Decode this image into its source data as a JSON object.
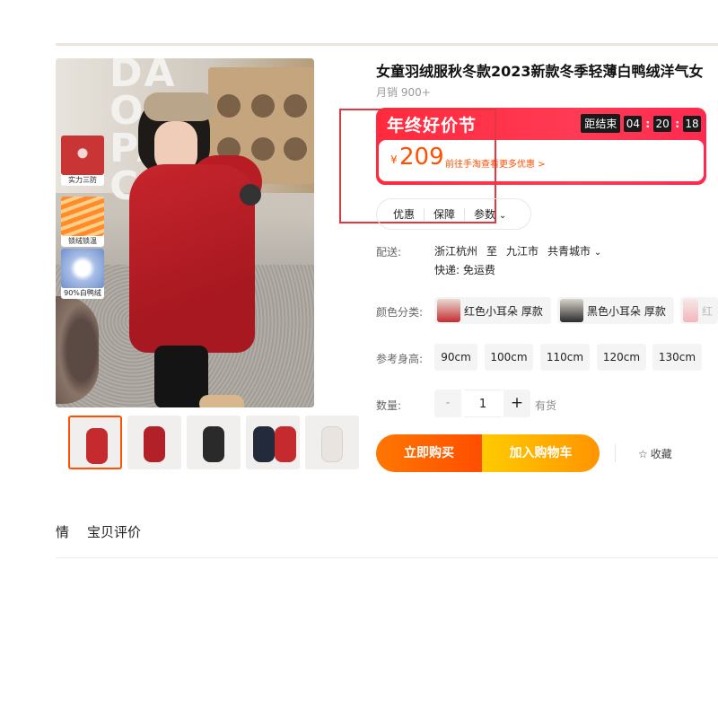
{
  "product": {
    "title": "女童羽绒服秋冬款2023新款冬季轻薄白鸭绒洋气女",
    "sales": "月销 900+"
  },
  "gallery": {
    "main_image_letters": "DA\nOS\nPA\nCE",
    "feature_tiles": [
      "实力三防",
      "锁绒锁温",
      "90%白鸭绒"
    ],
    "thumbnails": [
      {
        "color": "#c52a2f",
        "active": true
      },
      {
        "color": "#b22127",
        "active": false
      },
      {
        "color": "#2a2a2a",
        "active": false
      },
      {
        "color": "#222a3c",
        "active": false
      },
      {
        "color": "#e9e4df",
        "active": false
      }
    ]
  },
  "promo": {
    "title": "年终好价节",
    "countdown_label": "距结束",
    "hours": "04",
    "minutes": "20",
    "seconds": "18",
    "currency": "¥",
    "price": "209",
    "more_offers": "前往手淘查看更多优惠 >"
  },
  "info_tabs": [
    "优惠",
    "保障",
    "参数"
  ],
  "shipping": {
    "label": "配送:",
    "from": "浙江杭州",
    "to_word": "至",
    "to_city": "九江市",
    "district": "共青城市",
    "express": "快递: 免运费"
  },
  "colors": {
    "label": "颜色分类:",
    "options": [
      {
        "name": "红色小耳朵 厚款",
        "swatch": "#c62b31"
      },
      {
        "name": "黑色小耳朵 厚款",
        "swatch": "#2b2b2b"
      },
      {
        "name": "红",
        "swatch": "#f1b6bd"
      }
    ]
  },
  "sizes": {
    "label": "参考身高:",
    "options": [
      "90cm",
      "100cm",
      "110cm",
      "120cm",
      "130cm"
    ]
  },
  "quantity": {
    "label": "数量:",
    "minus": "-",
    "value": "1",
    "plus": "+",
    "stock": "有货"
  },
  "actions": {
    "buy_now": "立即购买",
    "add_to_cart": "加入购物车",
    "favorite": "收藏"
  },
  "bottom_tabs": [
    "情",
    "宝贝评价"
  ],
  "colors_theme": {
    "accent": "#ff5000",
    "promo_red": "#ff2a3d",
    "cart_yellow": "#ffcb00"
  }
}
